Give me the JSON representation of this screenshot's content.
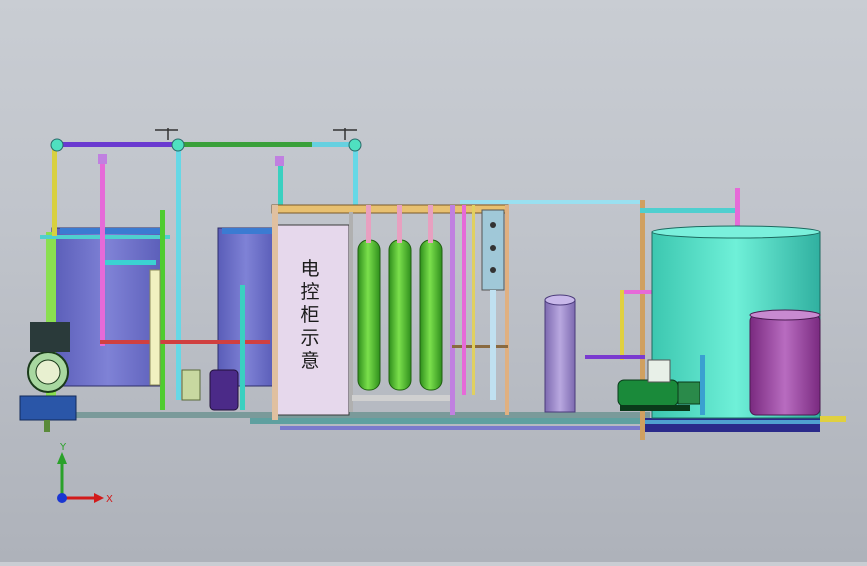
{
  "viewport": {
    "cabinet_label": "电控柜示意",
    "background_top": "#c9cdd3",
    "background_bottom": "#aeb2ba"
  },
  "triad": {
    "x_label": "X",
    "y_label": "Y",
    "x_color": "#d21a1a",
    "y_color": "#2aa12a",
    "z_color": "#1a36d2"
  },
  "components": [
    {
      "name": "tank-left",
      "icon": "tank-icon",
      "color": "#6f72c8"
    },
    {
      "name": "tank-middle",
      "icon": "tank-icon",
      "color": "#6f72c8"
    },
    {
      "name": "control-cabinet",
      "icon": "cabinet-icon",
      "color": "#e6d8ec"
    },
    {
      "name": "membrane-filter-1",
      "icon": "filter-column-icon",
      "color": "#4fbf2b"
    },
    {
      "name": "membrane-filter-2",
      "icon": "filter-column-icon",
      "color": "#4fbf2b"
    },
    {
      "name": "membrane-filter-3",
      "icon": "filter-column-icon",
      "color": "#4fbf2b"
    },
    {
      "name": "uv-sterilizer",
      "icon": "cylinder-icon",
      "color": "#9a86c8"
    },
    {
      "name": "storage-tank",
      "icon": "storage-tank-icon",
      "color": "#4fe0c0"
    },
    {
      "name": "pressure-tank",
      "icon": "cylinder-icon",
      "color": "#9a3aa0"
    },
    {
      "name": "raw-water-pump",
      "icon": "pump-icon",
      "color": "#2a56a8"
    },
    {
      "name": "dosing-pump",
      "icon": "pump-icon",
      "color": "#4b2a88"
    },
    {
      "name": "delivery-pump",
      "icon": "pump-icon",
      "color": "#1a8a3a"
    }
  ]
}
